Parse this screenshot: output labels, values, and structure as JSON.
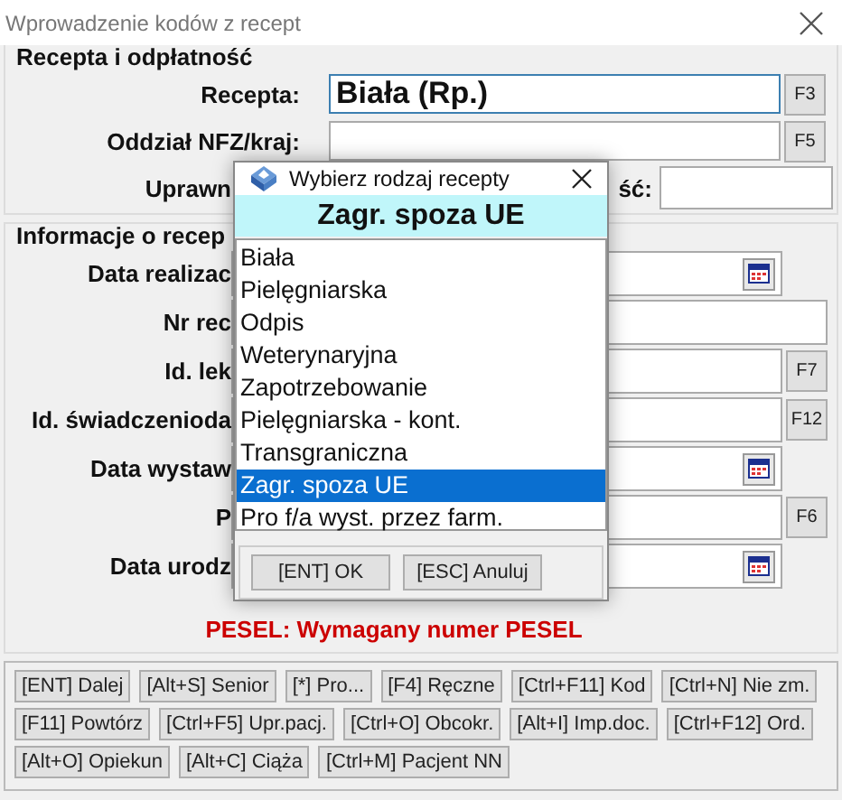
{
  "window": {
    "title": "Wprowadzenie kodów z recept"
  },
  "group_recepta": {
    "title": "Recepta i odpłatność",
    "rows": [
      {
        "label": "Recepta:",
        "value": "Biała (Rp.)",
        "key": "F3"
      },
      {
        "label": "Oddział NFZ/kraj:",
        "key": "F5"
      }
    ],
    "row_3": {
      "label": "Uprawn",
      "label_2": "ść:"
    }
  },
  "group_info": {
    "title": "Informacje o recep",
    "rows": [
      {
        "label": "Data realizac",
        "kind": "date"
      },
      {
        "label": "Nr rec",
        "kind": "text"
      },
      {
        "label": "Id. lek",
        "kind": "key",
        "key": "F7"
      },
      {
        "label": "Id. świadczenioda",
        "kind": "key",
        "key": "F12"
      },
      {
        "label": "Data wystaw",
        "kind": "date"
      },
      {
        "label": "P",
        "kind": "key",
        "key": "F6"
      },
      {
        "label": "Data urodz",
        "kind": "date"
      }
    ],
    "warning": "PESEL: Wymagany numer PESEL"
  },
  "shortcut_buttons": [
    [
      "[ENT] Dalej",
      "[Alt+S] Senior",
      "[*] Pro...",
      "[F4] Ręczne",
      "[Ctrl+F11] Kod",
      "[Ctrl+N] Nie zm."
    ],
    [
      "[F11] Powtórz",
      "[Ctrl+F5] Upr.pacj.",
      "[Ctrl+O] Obcokr.",
      "[Alt+I] Imp.doc.",
      "[Ctrl+F12] Ord."
    ],
    [
      "[Alt+O] Opiekun",
      "[Alt+C] Ciąża",
      "[Ctrl+M] Pacjent NN"
    ]
  ],
  "dialog": {
    "title": "Wybierz rodzaj recepty",
    "header": "Zagr. spoza UE",
    "options": [
      {
        "label": "Biała",
        "selected": false
      },
      {
        "label": "Pielęgniarska",
        "selected": false
      },
      {
        "label": "Odpis",
        "selected": false
      },
      {
        "label": "Weterynaryjna",
        "selected": false
      },
      {
        "label": "Zapotrzebowanie",
        "selected": false
      },
      {
        "label": "Pielęgniarska - kont.",
        "selected": false
      },
      {
        "label": "Transgraniczna",
        "selected": false
      },
      {
        "label": "Zagr. spoza UE",
        "selected": true
      },
      {
        "label": "Pro f/a wyst. przez farm.",
        "selected": false
      }
    ],
    "buttons": [
      "[ENT] OK",
      "[ESC] Anuluj"
    ]
  }
}
